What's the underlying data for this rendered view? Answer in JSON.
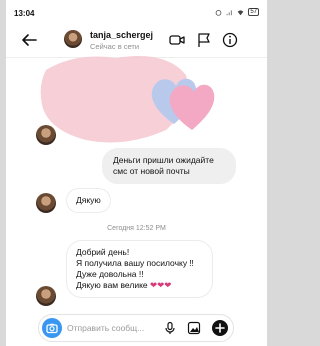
{
  "status_bar": {
    "time": "13:04",
    "battery": "57"
  },
  "header": {
    "username": "tanja_schergej",
    "status": "Сейчас в сети"
  },
  "messages": [
    {
      "from": "me",
      "text": "Деньги пришли ожидайте смс от новой почты"
    },
    {
      "from": "them",
      "text": "Дякую"
    },
    {
      "from": "them",
      "lines": [
        "Добрий день!",
        "Я получила вашу посилочку ‼",
        "Дуже довольна !!",
        "Дякую вам велике"
      ],
      "hearts": "❤❤❤"
    }
  ],
  "timestamp": "Сегодня 12:52 PM",
  "composer": {
    "placeholder": "Отправить сообщ..."
  },
  "colors": {
    "accent": "#3897f0",
    "pink": "#f6c7cf",
    "blue_heart": "#b9c9ec",
    "pink_heart": "#f3a9c3"
  }
}
